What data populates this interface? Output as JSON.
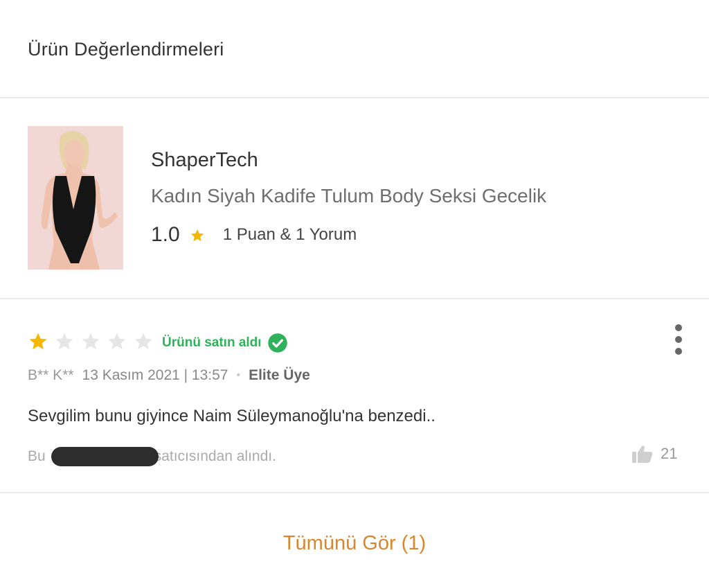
{
  "section": {
    "title": "Ürün Değerlendirmeleri"
  },
  "product": {
    "brand": "ShaperTech",
    "name": "Kadın Siyah Kadife Tulum Body Seksi Gecelik",
    "rating": "1.0",
    "rating_count": "1 Puan & 1 Yorum",
    "star_color": "#f5b800"
  },
  "review": {
    "stars": 1,
    "max_stars": 5,
    "verified_label": "Ürünü satın aldı",
    "author": "B** K**",
    "date": "13 Kasım 2021 | 13:57",
    "separator": "•",
    "member_label": "Elite Üye",
    "comment": "Sevgilim bunu giyince Naim Süleymanoğlu'na benzedi..",
    "seller_prefix": "Bu",
    "seller_suffix": "satıcısından alındı.",
    "likes": "21",
    "icons": {
      "verified": "check-circle-icon",
      "more": "more-vertical-icon",
      "like": "thumbs-up-icon"
    }
  },
  "footer": {
    "see_all_label": "Tümünü Gör (1)"
  },
  "colors": {
    "accent": "#d9862e",
    "verified": "#2fb25a",
    "star_filled": "#f5b800",
    "star_empty": "#e6e6e6"
  }
}
